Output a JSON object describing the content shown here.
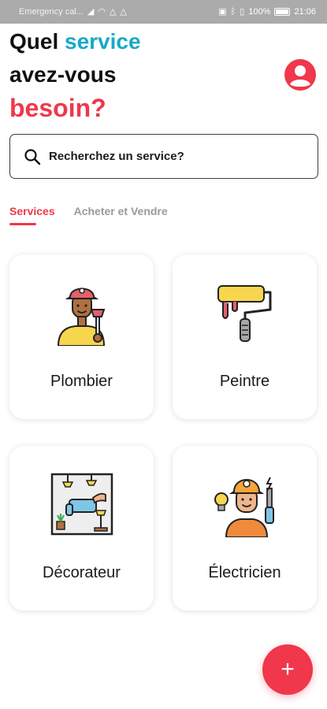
{
  "status_bar": {
    "carrier": "Emergency cal...",
    "battery_percent": "100%",
    "time": "21:06",
    "icons": [
      "signal-icon",
      "wifi-icon",
      "alert-icon",
      "alert-icon",
      "nfc-icon",
      "bluetooth-icon",
      "vibrate-icon",
      "battery-icon"
    ]
  },
  "header": {
    "line1_prefix": "Quel",
    "line1_highlight": "service",
    "line2": "avez-vous",
    "line3": "besoin?",
    "profile_icon": "user-avatar-icon"
  },
  "search": {
    "placeholder": "Recherchez un service?",
    "icon": "search-icon"
  },
  "tabs": [
    {
      "label": "Services",
      "active": true
    },
    {
      "label": "Acheter et Vendre",
      "active": false
    }
  ],
  "services": [
    {
      "label": "Plombier",
      "icon": "plumber-icon"
    },
    {
      "label": "Peintre",
      "icon": "paint-roller-icon"
    },
    {
      "label": "Décorateur",
      "icon": "decorator-room-icon"
    },
    {
      "label": "Électricien",
      "icon": "electrician-icon"
    }
  ],
  "fab": {
    "label": "+",
    "icon": "plus-icon"
  },
  "colors": {
    "accent_red": "#f0374b",
    "accent_teal": "#17a9c6",
    "status_bar_bg": "#ababab",
    "inactive_tab": "#9a9a9a"
  }
}
